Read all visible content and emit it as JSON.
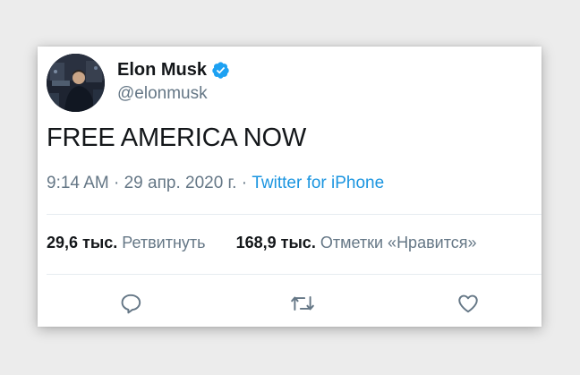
{
  "tweet": {
    "author": {
      "name": "Elon Musk",
      "handle": "@elonmusk",
      "verified": true
    },
    "text": "FREE AMERICA NOW",
    "time": "9:14 AM",
    "date": "29 апр. 2020 г.",
    "separator": "·",
    "source": "Twitter for iPhone",
    "stats": {
      "retweets_count": "29,6 тыс.",
      "retweets_label": "Ретвитнуть",
      "likes_count": "168,9 тыс.",
      "likes_label": "Отметки «Нравится»"
    },
    "actions": [
      "reply-icon",
      "retweet-icon",
      "like-icon"
    ]
  },
  "colors": {
    "verified": "#1da1f2",
    "link": "#1b95e0",
    "secondary_text": "#657786",
    "primary_text": "#14171a"
  }
}
